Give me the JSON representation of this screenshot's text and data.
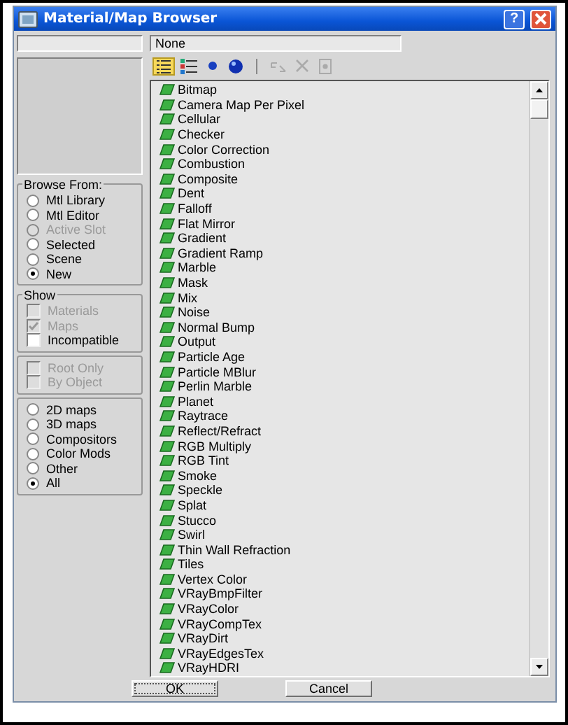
{
  "window": {
    "title": "Material/Map Browser",
    "help_label": "?"
  },
  "current_map": "None",
  "toolbar": [
    {
      "kind": "view-list",
      "selected": true,
      "disabled": false
    },
    {
      "kind": "view-list-icons",
      "selected": false,
      "disabled": false
    },
    {
      "kind": "small-icons",
      "selected": false,
      "disabled": false
    },
    {
      "kind": "large-icons",
      "selected": false,
      "disabled": false
    },
    {
      "kind": "update",
      "selected": false,
      "disabled": true
    },
    {
      "kind": "delete",
      "selected": false,
      "disabled": true
    },
    {
      "kind": "clear",
      "selected": false,
      "disabled": true
    }
  ],
  "browse_from": {
    "title": "Browse From:",
    "options": [
      {
        "label": "Mtl Library",
        "selected": false,
        "disabled": false
      },
      {
        "label": "Mtl Editor",
        "selected": false,
        "disabled": false
      },
      {
        "label": "Active Slot",
        "selected": false,
        "disabled": true
      },
      {
        "label": "Selected",
        "selected": false,
        "disabled": false
      },
      {
        "label": "Scene",
        "selected": false,
        "disabled": false
      },
      {
        "label": "New",
        "selected": true,
        "disabled": false
      }
    ]
  },
  "show": {
    "title": "Show",
    "options": [
      {
        "label": "Materials",
        "checked": false,
        "disabled": true
      },
      {
        "label": "Maps",
        "checked": true,
        "disabled": true
      },
      {
        "label": "Incompatible",
        "checked": false,
        "disabled": false
      }
    ]
  },
  "scope": [
    {
      "label": "Root Only",
      "checked": false,
      "disabled": true
    },
    {
      "label": "By Object",
      "checked": false,
      "disabled": true
    }
  ],
  "filters": [
    {
      "label": "2D maps",
      "selected": false
    },
    {
      "label": "3D maps",
      "selected": false
    },
    {
      "label": "Compositors",
      "selected": false
    },
    {
      "label": "Color Mods",
      "selected": false
    },
    {
      "label": "Other",
      "selected": false
    },
    {
      "label": "All",
      "selected": true
    }
  ],
  "items": [
    "Bitmap",
    "Camera Map Per Pixel",
    "Cellular",
    "Checker",
    "Color Correction",
    "Combustion",
    "Composite",
    "Dent",
    "Falloff",
    "Flat Mirror",
    "Gradient",
    "Gradient Ramp",
    "Marble",
    "Mask",
    "Mix",
    "Noise",
    "Normal Bump",
    "Output",
    "Particle Age",
    "Particle MBlur",
    "Perlin Marble",
    "Planet",
    "Raytrace",
    "Reflect/Refract",
    "RGB Multiply",
    "RGB Tint",
    "Smoke",
    "Speckle",
    "Splat",
    "Stucco",
    "Swirl",
    "Thin Wall Refraction",
    "Tiles",
    "Vertex Color",
    "VRayBmpFilter",
    "VRayColor",
    "VRayCompTex",
    "VRayDirt",
    "VRayEdgesTex",
    "VRayHDRI"
  ],
  "buttons": [
    "OK",
    "Cancel"
  ]
}
